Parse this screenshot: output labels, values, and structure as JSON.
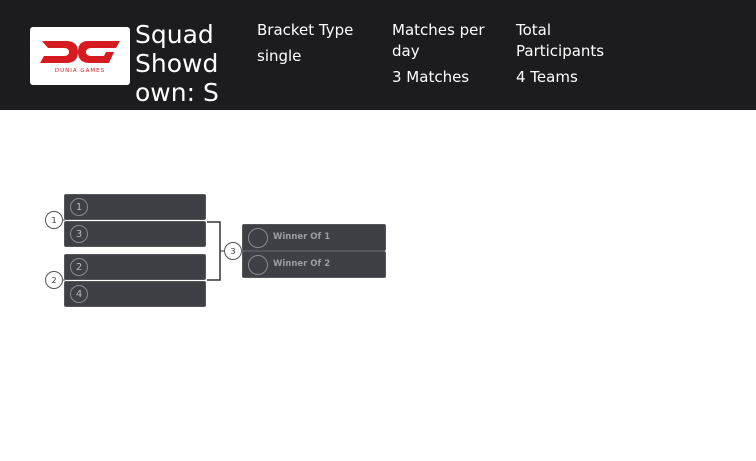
{
  "header": {
    "logo_text": "DUNIA GAMES",
    "title": "Squad Showdown: S",
    "bracket_type_label": "Bracket Type",
    "bracket_type_value": "single",
    "matches_per_day_label": "Matches per day",
    "matches_per_day_value": "3 Matches",
    "total_participants_label": "Total Participants",
    "total_participants_value": "4 Teams"
  },
  "bracket": {
    "round1": [
      {
        "match": "1",
        "teams": [
          "1",
          "3"
        ]
      },
      {
        "match": "2",
        "teams": [
          "2",
          "4"
        ]
      }
    ],
    "round2": {
      "match": "3",
      "teams": [
        "Winner Of 1",
        "Winner Of 2"
      ]
    }
  },
  "colors": {
    "header_bg": "#1c1c1e",
    "box_bg": "#3f4046",
    "logo_red": "#d71920"
  }
}
